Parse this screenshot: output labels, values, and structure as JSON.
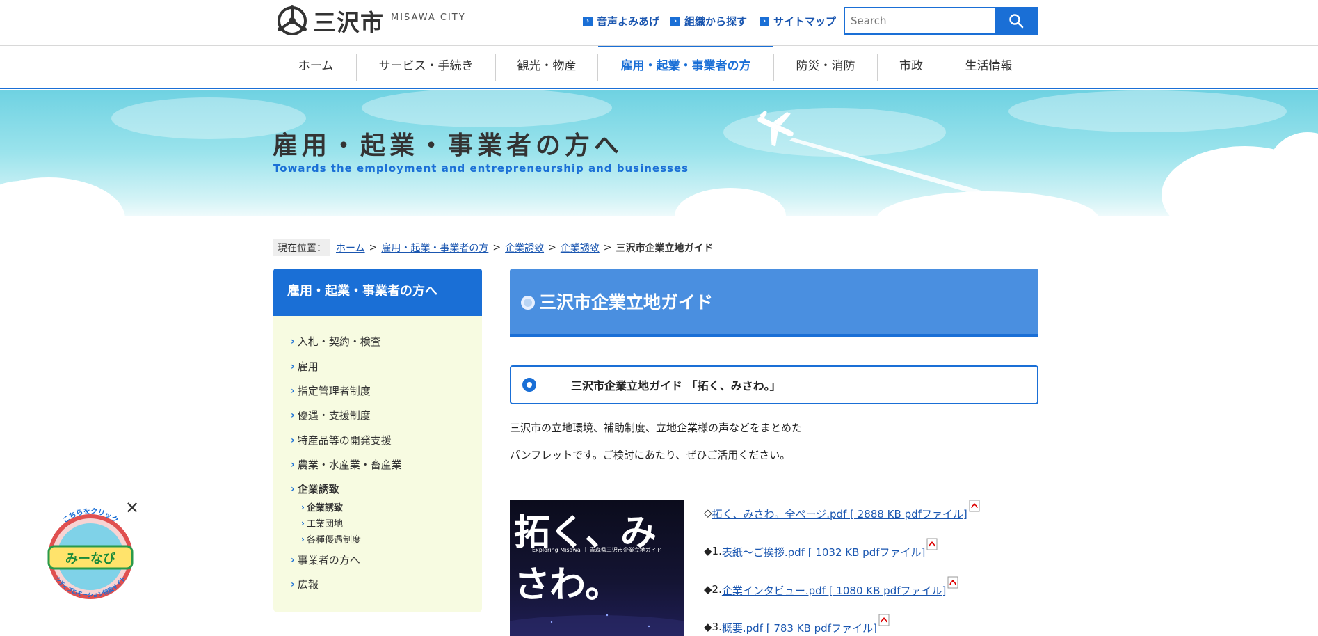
{
  "header": {
    "logo_text": "三沢市",
    "logo_sub": "MISAWA CITY",
    "util_links": [
      "音声よみあげ",
      "組織から探す",
      "サイトマップ"
    ],
    "search_placeholder": "Search"
  },
  "nav": {
    "items": [
      "ホーム",
      "サービス・手続き",
      "観光・物産",
      "雇用・起業・事業者の方",
      "防災・消防",
      "市政",
      "生活情報"
    ],
    "active_index": 3
  },
  "banner": {
    "title": "雇用・起業・事業者の方へ",
    "subtitle": "Towards the employment and entrepreneurship and businesses"
  },
  "breadcrumb": {
    "label": "現在位置：",
    "links": [
      "ホーム",
      "雇用・起業・事業者の方",
      "企業誘致",
      "企業誘致"
    ],
    "current": "三沢市企業立地ガイド"
  },
  "sidebar": {
    "heading": "雇用・起業・事業者の方へ",
    "items": [
      "入札・契約・検査",
      "雇用",
      "指定管理者制度",
      "優遇・支援制度",
      "特産品等の開発支援",
      "農業・水産業・畜産業",
      "企業誘致",
      "事業者の方へ",
      "広報"
    ],
    "current_item": "企業誘致",
    "subitems": [
      "企業誘致",
      "工業団地",
      "各種優遇制度"
    ],
    "current_subitem": "企業誘致"
  },
  "main": {
    "title": "三沢市企業立地ガイド",
    "section_title": "三沢市企業立地ガイド 「拓く、みさわ。」",
    "paragraph_1": "三沢市の立地環境、補助制度、立地企業様の声などをまとめた",
    "paragraph_2": "パンフレットです。ご検討にあたり、ぜひご活用ください。",
    "cover_title": "拓く、みさわ。",
    "cover_sub": "Exploring Misawa ｜ 青森県三沢市企業立地ガイド",
    "pdf_links": [
      {
        "prefix": "◇",
        "text": "拓く、みさわ。全ページ.pdf [ 2888 KB pdfファイル]"
      },
      {
        "prefix": "◆1.",
        "text": "表紙～ご挨拶.pdf [ 1032 KB pdfファイル]"
      },
      {
        "prefix": "◆2.",
        "text": "企業インタビュー.pdf [ 1080 KB pdfファイル]"
      },
      {
        "prefix": "◆3.",
        "text": "概要.pdf [ 783 KB pdfファイル]"
      }
    ]
  },
  "mascot": {
    "top_text": "こちらをクリック",
    "logo_text": "みーなび",
    "bottom_text": "シティプロモーション特設サイト",
    "close_label": "✕"
  },
  "colors": {
    "accent": "#1a6fd6",
    "title_bg": "#4a8fe0",
    "sidebar_bg": "#f7fbe1"
  }
}
